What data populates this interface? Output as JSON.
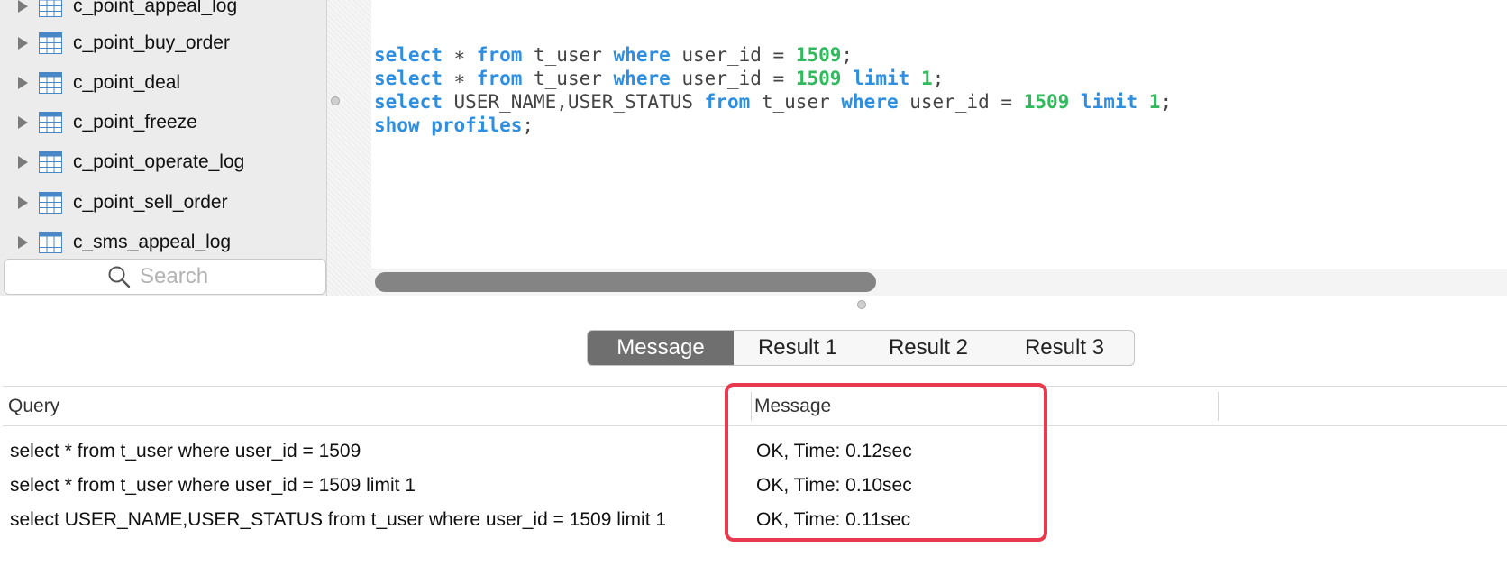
{
  "sidebar": {
    "tables": [
      {
        "name": "c_point_appeal_log"
      },
      {
        "name": "c_point_buy_order"
      },
      {
        "name": "c_point_deal"
      },
      {
        "name": "c_point_freeze"
      },
      {
        "name": "c_point_operate_log"
      },
      {
        "name": "c_point_sell_order"
      },
      {
        "name": "c_sms_appeal_log"
      }
    ],
    "search_placeholder": "Search"
  },
  "editor": {
    "lines": [
      "select * from t_user where user_id = 1509;",
      "select * from t_user where user_id = 1509 limit 1;",
      "select USER_NAME,USER_STATUS from t_user where user_id = 1509 limit 1;",
      "show profiles;"
    ]
  },
  "tabs": [
    {
      "label": "Message",
      "active": true
    },
    {
      "label": "Result 1",
      "active": false
    },
    {
      "label": "Result 2",
      "active": false
    },
    {
      "label": "Result 3",
      "active": false
    }
  ],
  "results": {
    "columns": [
      "Query",
      "Message"
    ],
    "rows": [
      {
        "query": "select * from t_user where user_id = 1509",
        "message": "OK, Time: 0.12sec"
      },
      {
        "query": "select * from t_user where user_id = 1509 limit 1",
        "message": "OK, Time: 0.10sec"
      },
      {
        "query": "select USER_NAME,USER_STATUS from t_user where user_id = 1509 limit 1",
        "message": "OK, Time: 0.11sec"
      }
    ]
  },
  "colors": {
    "keyword": "#2e8ee0",
    "number": "#2fba5c",
    "active_tab": "#6f6f6f",
    "highlight": "#e8394e"
  },
  "icons": [
    "disclosure-triangle-icon",
    "table-icon",
    "search-icon"
  ]
}
